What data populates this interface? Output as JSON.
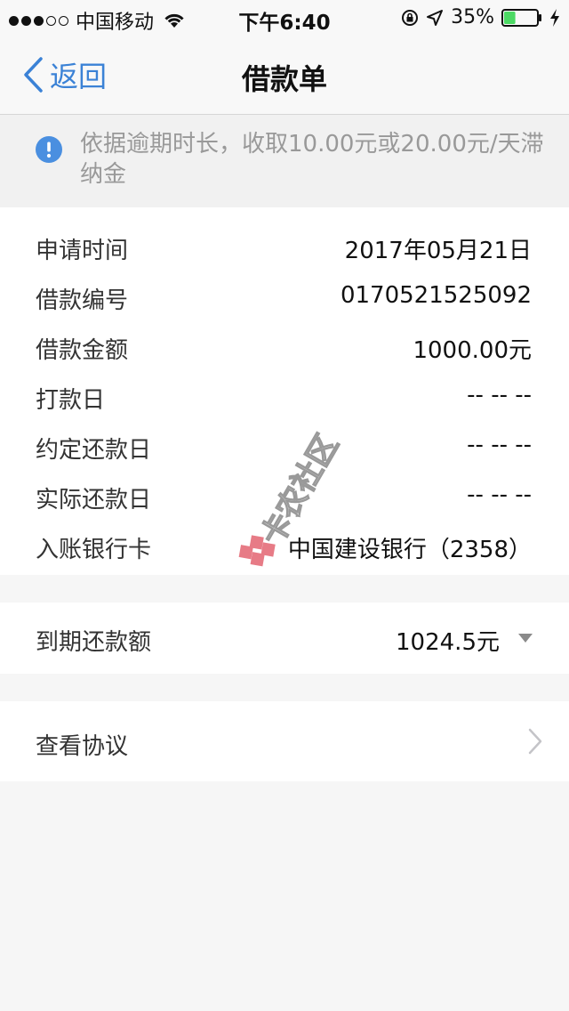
{
  "status_bar": {
    "carrier": "中国移动",
    "time": "下午6:40",
    "battery": "35%",
    "battery_fill": 0.35
  },
  "nav": {
    "back_label": "返回",
    "title": "借款单"
  },
  "notice": {
    "text": "依据逾期时长，收取10.00元或20.00元/天滞纳金"
  },
  "details": [
    {
      "label": "申请时间",
      "value": "2017年05月21日"
    },
    {
      "label": "借款编号",
      "value": "0170521525092"
    },
    {
      "label": "借款金额",
      "value": "1000.00元"
    },
    {
      "label": "打款日",
      "value": "-- -- --"
    },
    {
      "label": "约定还款日",
      "value": "-- -- --"
    },
    {
      "label": "实际还款日",
      "value": "-- -- --"
    },
    {
      "label": "入账银行卡",
      "value": "中国建设银行（2358）"
    }
  ],
  "due": {
    "label": "到期还款额",
    "value": "1024.5元"
  },
  "agreement": {
    "label": "查看协议"
  },
  "watermark": {
    "text": "卡农社区"
  },
  "colors": {
    "accent": "#3b82d6",
    "info": "#4a8fe0",
    "battery": "#4cd964",
    "watermark": "#e0505e"
  }
}
